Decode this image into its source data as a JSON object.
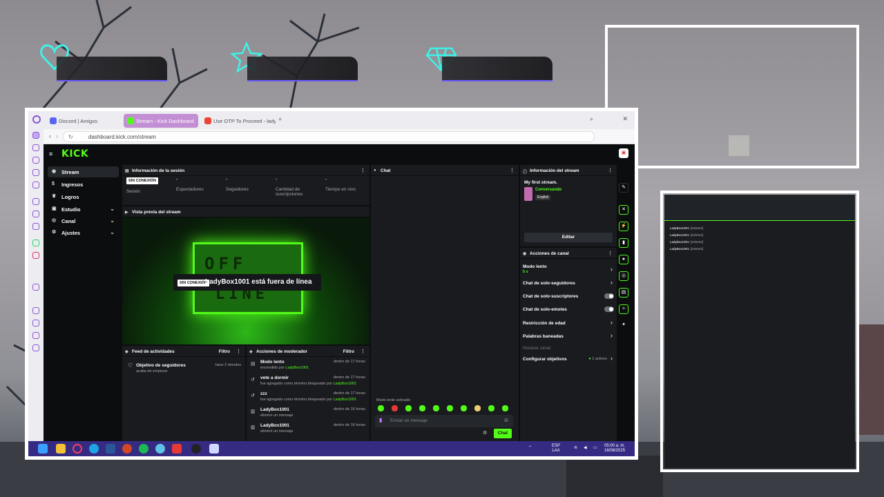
{
  "browser": {
    "tabs": [
      {
        "label": "Discord | Amigos",
        "icon": "discord-icon"
      },
      {
        "label": "Stream - Kick Dashboard",
        "icon": "kick-icon",
        "active": true
      },
      {
        "label": "Use OTP To Proceed - ladyb",
        "icon": "gmail-icon"
      }
    ],
    "url": "dashboard.kick.com/stream"
  },
  "kick": {
    "logo": "KICK",
    "nav": [
      {
        "label": "Stream",
        "icon": "broadcast-icon"
      },
      {
        "label": "Ingresos",
        "icon": "money-icon"
      },
      {
        "label": "Logros",
        "icon": "trophy-icon"
      },
      {
        "label": "Estudio",
        "icon": "studio-icon"
      },
      {
        "label": "Canal",
        "icon": "channel-icon"
      },
      {
        "label": "Ajustes",
        "icon": "gear-icon"
      }
    ]
  },
  "session": {
    "title": "Información de la sesión",
    "stats": [
      {
        "value": "SIN CONEXIÓN",
        "label": "Sesión"
      },
      {
        "value": "-",
        "label": "Espectadores"
      },
      {
        "value": "-",
        "label": "Seguidores"
      },
      {
        "value": "-",
        "label": "Cantidad de suscripciones"
      },
      {
        "value": "-",
        "label": "Tiempo en vivo"
      }
    ]
  },
  "preview": {
    "title": "Vista previa del stream",
    "offline_badge": "SIN CONEXIÓN",
    "offline_text": "LadyBox1001 está fuera de línea",
    "offline_art_top": "OFF",
    "offline_art_bottom": "LINE"
  },
  "activity": {
    "title": "Feed de actividades",
    "filter": "Filtro",
    "items": [
      {
        "title": "Objetivo de seguidores",
        "sub": "acaba de empezar",
        "time": "hace 2 minutos"
      }
    ]
  },
  "modactions": {
    "title": "Acciones de moderador",
    "filter": "Filtro",
    "items": [
      {
        "title": "Modo lento",
        "sub": "encendido por",
        "user": "LadyBox1001",
        "time": "dentro de 17 horas"
      },
      {
        "title": "vete a dormir",
        "sub": "fue agregado como término bloqueado por",
        "user": "LadyBox1001",
        "time": "dentro de 17 horas"
      },
      {
        "title": "zzz",
        "sub": "fue agregado como término bloqueado por",
        "user": "LadyBox1001",
        "time": "dentro de 17 horas"
      },
      {
        "title": "LadyBox1001",
        "sub": "eliminó un mensaje",
        "user": "",
        "time": "dentro de 16 horas"
      },
      {
        "title": "LadyBox1001",
        "sub": "eliminó un mensaje",
        "user": "",
        "time": "dentro de 16 horas"
      }
    ]
  },
  "chat": {
    "title": "Chat",
    "slow_mode": "Modo lento activado",
    "placeholder": "Enviar un mensaje",
    "send": "Chat"
  },
  "streaminfo": {
    "title": "Información del stream",
    "stream_title": "My first stream.",
    "category": "Conversando",
    "language": "English",
    "edit": "Editar"
  },
  "channel_actions": {
    "title": "Acciones de canal",
    "items": [
      {
        "label": "Modo lento",
        "sub": "5 s"
      },
      {
        "label": "Chat de solo-seguidores"
      },
      {
        "label": "Chat de solo-suscriptores"
      },
      {
        "label": "Chat de solo-emotes"
      },
      {
        "label": "Restricción de edad"
      },
      {
        "label": "Palabras baneadas"
      },
      {
        "label": "Hostear canal"
      },
      {
        "label": "Configurar objetivos",
        "sub": "1 activos"
      }
    ]
  },
  "taskbar": {
    "lang": "ESP",
    "lang2": "LAA",
    "time": "05:00 a. m.",
    "date": "16/08/2025"
  },
  "chat_overlay": {
    "messages": [
      {
        "user": "LadyBox1001:",
        "text": "[Deleted]"
      },
      {
        "user": "LadyBox1001:",
        "text": "[Deleted]"
      },
      {
        "user": "LadyBox1001:",
        "text": "[Deleted]"
      },
      {
        "user": "LadyBox1001:",
        "text": "[Deleted]"
      }
    ]
  },
  "colors": {
    "kick_green": "#53fc18",
    "taskbar": "#352b83",
    "overlay_cyan": "#3ef2e6",
    "accent_purple": "#8b55d8"
  }
}
